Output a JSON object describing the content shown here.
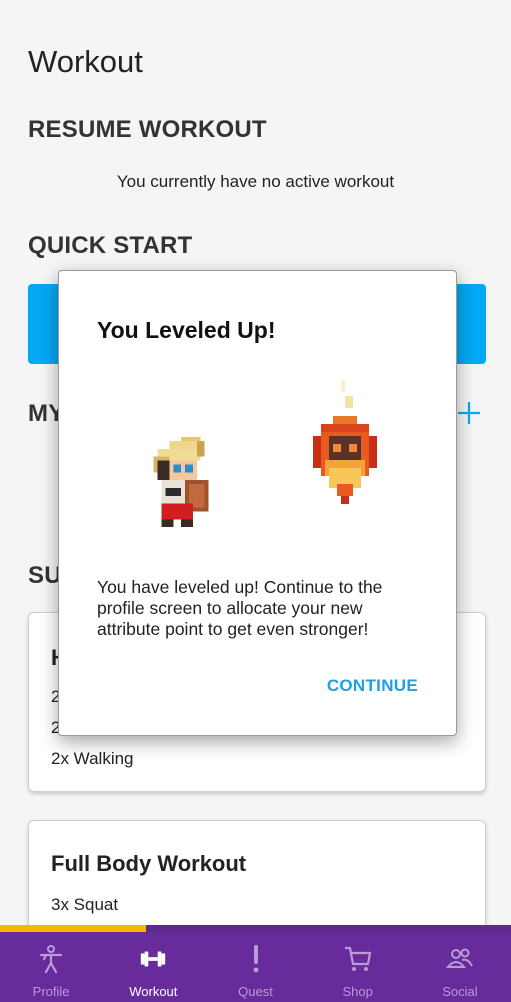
{
  "page": {
    "title": "Workout"
  },
  "resume": {
    "heading": "RESUME WORKOUT",
    "empty_text": "You currently have no active workout"
  },
  "quick_start": {
    "heading": "QUICK START"
  },
  "my_workouts": {
    "heading": "MY"
  },
  "suggested": {
    "heading": "SU"
  },
  "cards": [
    {
      "title": "H",
      "exercises": [
        "2",
        "2",
        "2x Walking"
      ]
    },
    {
      "title": "Full Body Workout",
      "exercises": [
        "3x Squat"
      ]
    }
  ],
  "dialog": {
    "title": "You Leveled Up!",
    "message": "You have leveled up! Continue to the profile screen to allocate your new attribute point to get even stronger!",
    "continue_label": "CONTINUE"
  },
  "xp_progress": 0.285,
  "nav": [
    {
      "label": "Profile",
      "icon": "profile-icon",
      "active": false
    },
    {
      "label": "Workout",
      "icon": "dumbbell-icon",
      "active": true
    },
    {
      "label": "Quest",
      "icon": "exclamation-icon",
      "active": false
    },
    {
      "label": "Shop",
      "icon": "cart-icon",
      "active": false
    },
    {
      "label": "Social",
      "icon": "people-icon",
      "active": false
    }
  ],
  "colors": {
    "accent": "#03a9f4",
    "nav_bg": "#672b9c",
    "xp": "#f5b800",
    "continue": "#1ea0e6"
  }
}
